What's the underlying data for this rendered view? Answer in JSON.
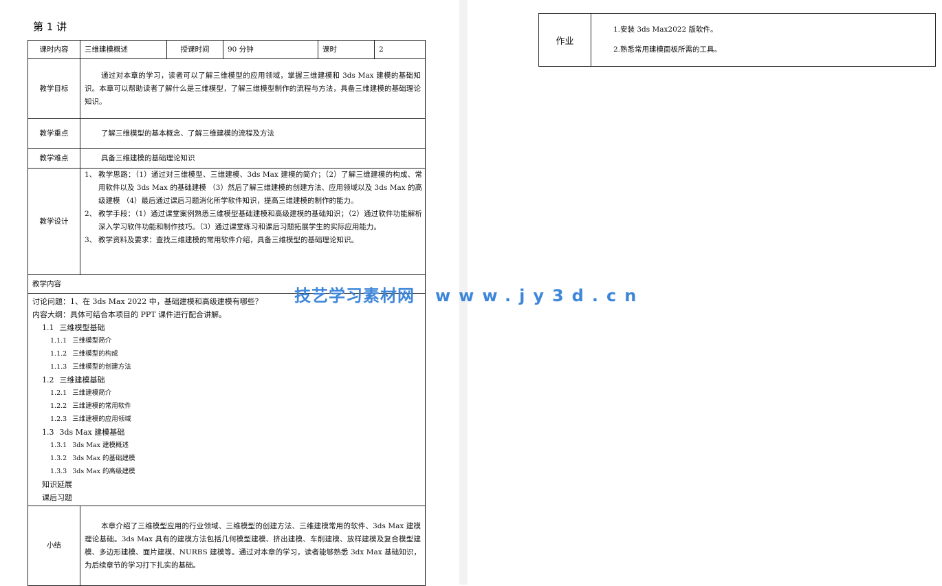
{
  "lecture": {
    "title": "第 1 讲"
  },
  "header_row": {
    "content_label": "课时内容",
    "content_value": "三维建模概述",
    "time_label": "授课时间",
    "time_value": "90 分钟",
    "hours_label": "课时",
    "hours_value": "2"
  },
  "goal": {
    "label": "教学目标",
    "text": "通过对本章的学习，读者可以了解三维模型的应用领域，掌握三维建模和 3ds Max 建模的基础知识。本章可以帮助读者了解什么是三维模型，了解三维模型制作的流程与方法，具备三维建模的基础理论知识。"
  },
  "key_points": {
    "label": "教学重点",
    "text": "了解三维模型的基本概念、了解三维建模的流程及方法"
  },
  "difficulties": {
    "label": "教学难点",
    "text": "具备三维建模的基础理论知识"
  },
  "design": {
    "label": "教学设计",
    "items": [
      {
        "num": "1、",
        "text": "教学思路：（1）通过对三维模型、三维建模、3ds Max 建模的简介；（2）了解三维建模的构成、常用软件以及 3ds Max 的基础建模 （3）然后了解三维建模的创建方法、应用领域以及 3ds Max 的高级建模 （4）最后通过课后习题消化所学软件知识，提高三维建模的制作的能力。"
      },
      {
        "num": "2、",
        "text": "教学手段：（1）通过课堂案例熟悉三维模型基础建模和高级建模的基础知识；（2）通过软件功能解析深入学习软件功能和制作技巧。（3）通过课堂练习和课后习题拓展学生的实际应用能力。"
      },
      {
        "num": "3、",
        "text": "教学资料及要求：查找三维建模的常用软件介绍，具备三维模型的基础理论知识。"
      }
    ]
  },
  "content": {
    "label": "教学内容",
    "discussion": "讨论问题：1、在 3ds Max 2022 中，基础建模和高级建模有哪些？",
    "outline_intro": "内容大纲：具体可结合本项目的 PPT 课件进行配合讲解。",
    "sections": [
      {
        "num": "1.1",
        "title": "三维模型基础",
        "subs": [
          {
            "num": "1.1.1",
            "title": "三维模型简介"
          },
          {
            "num": "1.1.2",
            "title": "三维模型的构成"
          },
          {
            "num": "1.1.3",
            "title": "三维模型的创建方法"
          }
        ]
      },
      {
        "num": "1.2",
        "title": "三维建模基础",
        "subs": [
          {
            "num": "1.2.1",
            "title": "三维建模简介"
          },
          {
            "num": "1.2.2",
            "title": "三维建模的常用软件"
          },
          {
            "num": "1.2.3",
            "title": "三维建模的应用领域"
          }
        ]
      },
      {
        "num": "1.3",
        "title": "3ds Max 建模基础",
        "subs": [
          {
            "num": "1.3.1",
            "title": "3ds Max 建模概述"
          },
          {
            "num": "1.3.2",
            "title": "3ds Max 的基础建模"
          },
          {
            "num": "1.3.3",
            "title": "3ds Max 的高级建模"
          }
        ]
      }
    ],
    "extension": "知识延展",
    "exercises": "课后习题"
  },
  "summary": {
    "label": "小结",
    "text": "本章介绍了三维模型应用的行业领域、三维模型的创建方法、三维建模常用的软件、3ds Max 建模理论基础。3ds Max 具有的建模方法包括几何模型建模、挤出建模、车削建模、放样建模及复合模型建模、多边形建模、面片建模、NURBS 建模等。通过对本章的学习，读者能够熟悉 3dx Max 基础知识，为后续章节的学习打下扎实的基础。"
  },
  "homework": {
    "label": "作业",
    "items": [
      "1.安装 3ds Max2022 版软件。",
      "2.熟悉常用建模面板所需的工具。"
    ]
  },
  "watermark": {
    "brand": "技艺学习素材网",
    "url": "www.jy3d.cn",
    "color": "#3d86d9"
  }
}
